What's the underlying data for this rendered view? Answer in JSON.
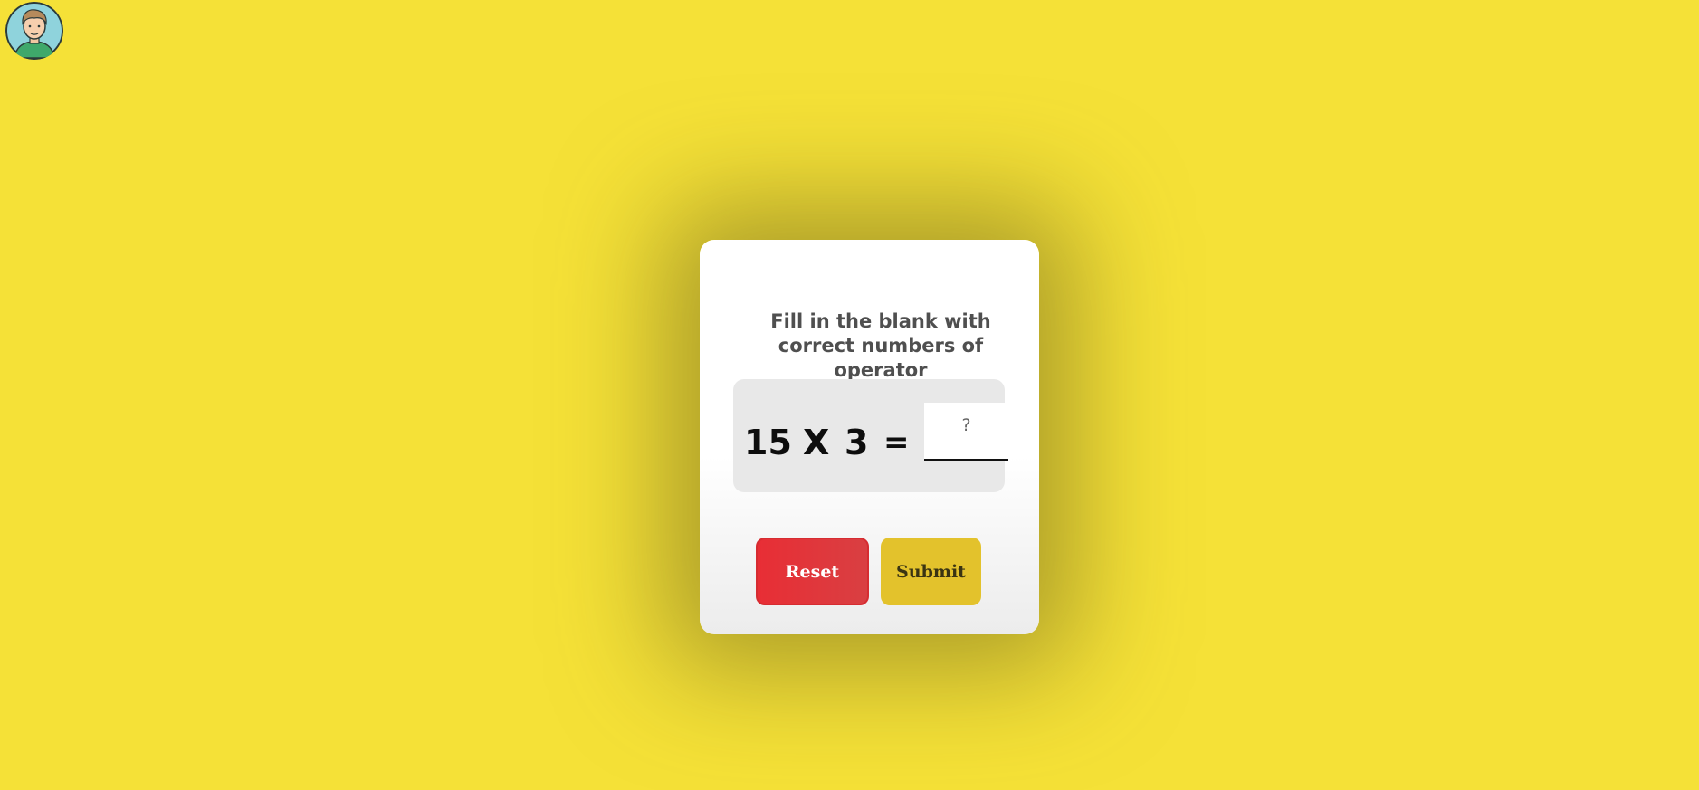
{
  "colors": {
    "page_background": "#f5e137",
    "reset_button": "#e82e35",
    "submit_button": "#e3c22c"
  },
  "avatar": {
    "icon": "user-avatar-icon"
  },
  "quiz": {
    "prompt": "Fill in the blank with correct numbers of operator",
    "equation": {
      "left_operand": "15",
      "operator": "X",
      "right_operand": "3",
      "equals": "=",
      "answer_value": "",
      "answer_placeholder": "?"
    },
    "buttons": {
      "reset_label": "Reset",
      "submit_label": "Submit"
    }
  }
}
